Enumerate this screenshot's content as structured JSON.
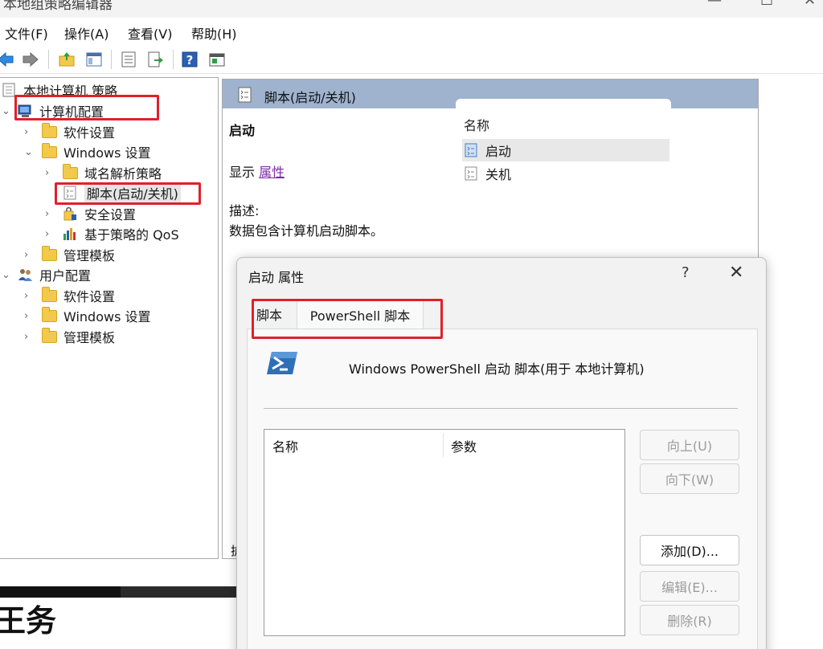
{
  "window": {
    "title": "本地组策略编辑器",
    "controls": {
      "minimize": "—",
      "maximize": "☐",
      "close": "✕"
    }
  },
  "menu": [
    "文件(F)",
    "操作(A)",
    "查看(V)",
    "帮助(H)"
  ],
  "toolbar": [
    "back-icon",
    "forward-icon",
    "up-folder-icon",
    "show-hide-tree-icon",
    "properties-icon",
    "export-icon",
    "help-icon",
    "console-icon"
  ],
  "tree": {
    "root": "本地计算机 策略",
    "computer_config": "计算机配置",
    "cc_software": "软件设置",
    "cc_windows": "Windows 设置",
    "cc_dns": "域名解析策略",
    "cc_scripts": "脚本(启动/关机)",
    "cc_security": "安全设置",
    "cc_qos": "基于策略的 QoS",
    "cc_admin": "管理模板",
    "user_config": "用户配置",
    "uc_software": "软件设置",
    "uc_windows": "Windows 设置",
    "uc_admin": "管理模板"
  },
  "right": {
    "header": "脚本(启动/关机)",
    "section_title": "启动",
    "show_label": "显示",
    "properties_link": "属性",
    "desc_label": "描述:",
    "desc_text": "数据包含计算机启动脚本。",
    "list_header": "名称",
    "items": [
      "启动",
      "关机"
    ],
    "tab_stub": "扩"
  },
  "dialog": {
    "title": "启动 属性",
    "help": "?",
    "close": "✕",
    "tabs": [
      "脚本",
      "PowerShell 脚本"
    ],
    "ps_heading": "Windows PowerShell 启动 脚本(用于 本地计算机)",
    "columns": [
      "名称",
      "参数"
    ],
    "buttons": {
      "up": "向上(U)",
      "down": "向下(W)",
      "add": "添加(D)...",
      "edit": "编辑(E)...",
      "remove": "删除(R)"
    }
  },
  "background_text": "王务",
  "colors": {
    "highlight_box": "#e0202a",
    "pane_header": "#9fb3cf",
    "link": "#7a2aa8"
  }
}
